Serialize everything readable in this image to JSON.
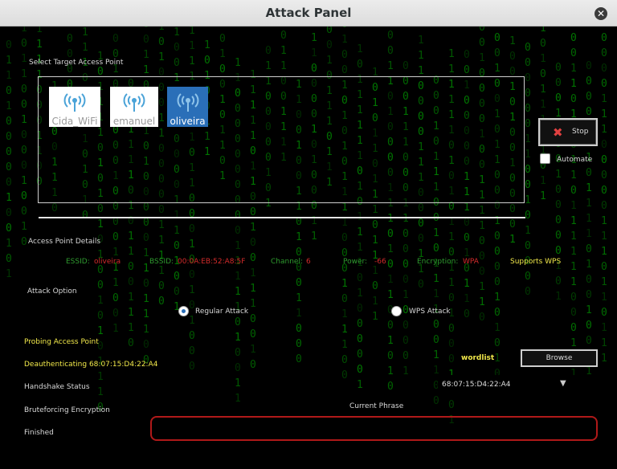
{
  "window": {
    "title": "Attack Panel"
  },
  "target": {
    "label": "Select Target Access Point",
    "access_points": [
      {
        "name": "Cida_WiFi",
        "icon": "wifi-antenna-icon",
        "selected": false
      },
      {
        "name": "emanuel",
        "icon": "wifi-antenna-icon",
        "selected": false
      },
      {
        "name": "oliveira",
        "icon": "wifi-antenna-icon",
        "selected": true
      }
    ]
  },
  "controls": {
    "stop_label": "Stop",
    "automate_label": "Automate",
    "automate_checked": false
  },
  "details": {
    "label": "Access Point Details",
    "essid_label": "ESSID:",
    "essid": "oliveira",
    "bssid_label": "BSSID:",
    "bssid": "00:0A:EB:52:A8:5F",
    "channel_label": "Channel:",
    "channel": "6",
    "power_label": "Power:",
    "power": "-66",
    "encryption_label": "Encryption:",
    "encryption": "WPA",
    "wps": "Supports WPS"
  },
  "attack_option": {
    "label": "Attack Option",
    "regular_label": "Regular Attack",
    "wps_label": "WPS  Attack",
    "selected": "regular"
  },
  "status": {
    "probing": "Probing Access Point",
    "deauth": "Deauthenticating 68:07:15:D4:22:A4",
    "handshake": "Handshake Status",
    "bruteforce": "Bruteforcing Encryption",
    "finished": "Finished"
  },
  "wordlist": {
    "label": "wordlist",
    "browse_label": "Browse",
    "selected_value": "68:07:15:D4:22:A4"
  },
  "phrase": {
    "label": "Current Phrase",
    "value": ""
  },
  "colors": {
    "accent": "#2a6fb8",
    "active_text": "#f1e84a",
    "detail_label": "#2f9b2f",
    "detail_value": "#d42b2b",
    "phrase_border": "#b01919"
  }
}
